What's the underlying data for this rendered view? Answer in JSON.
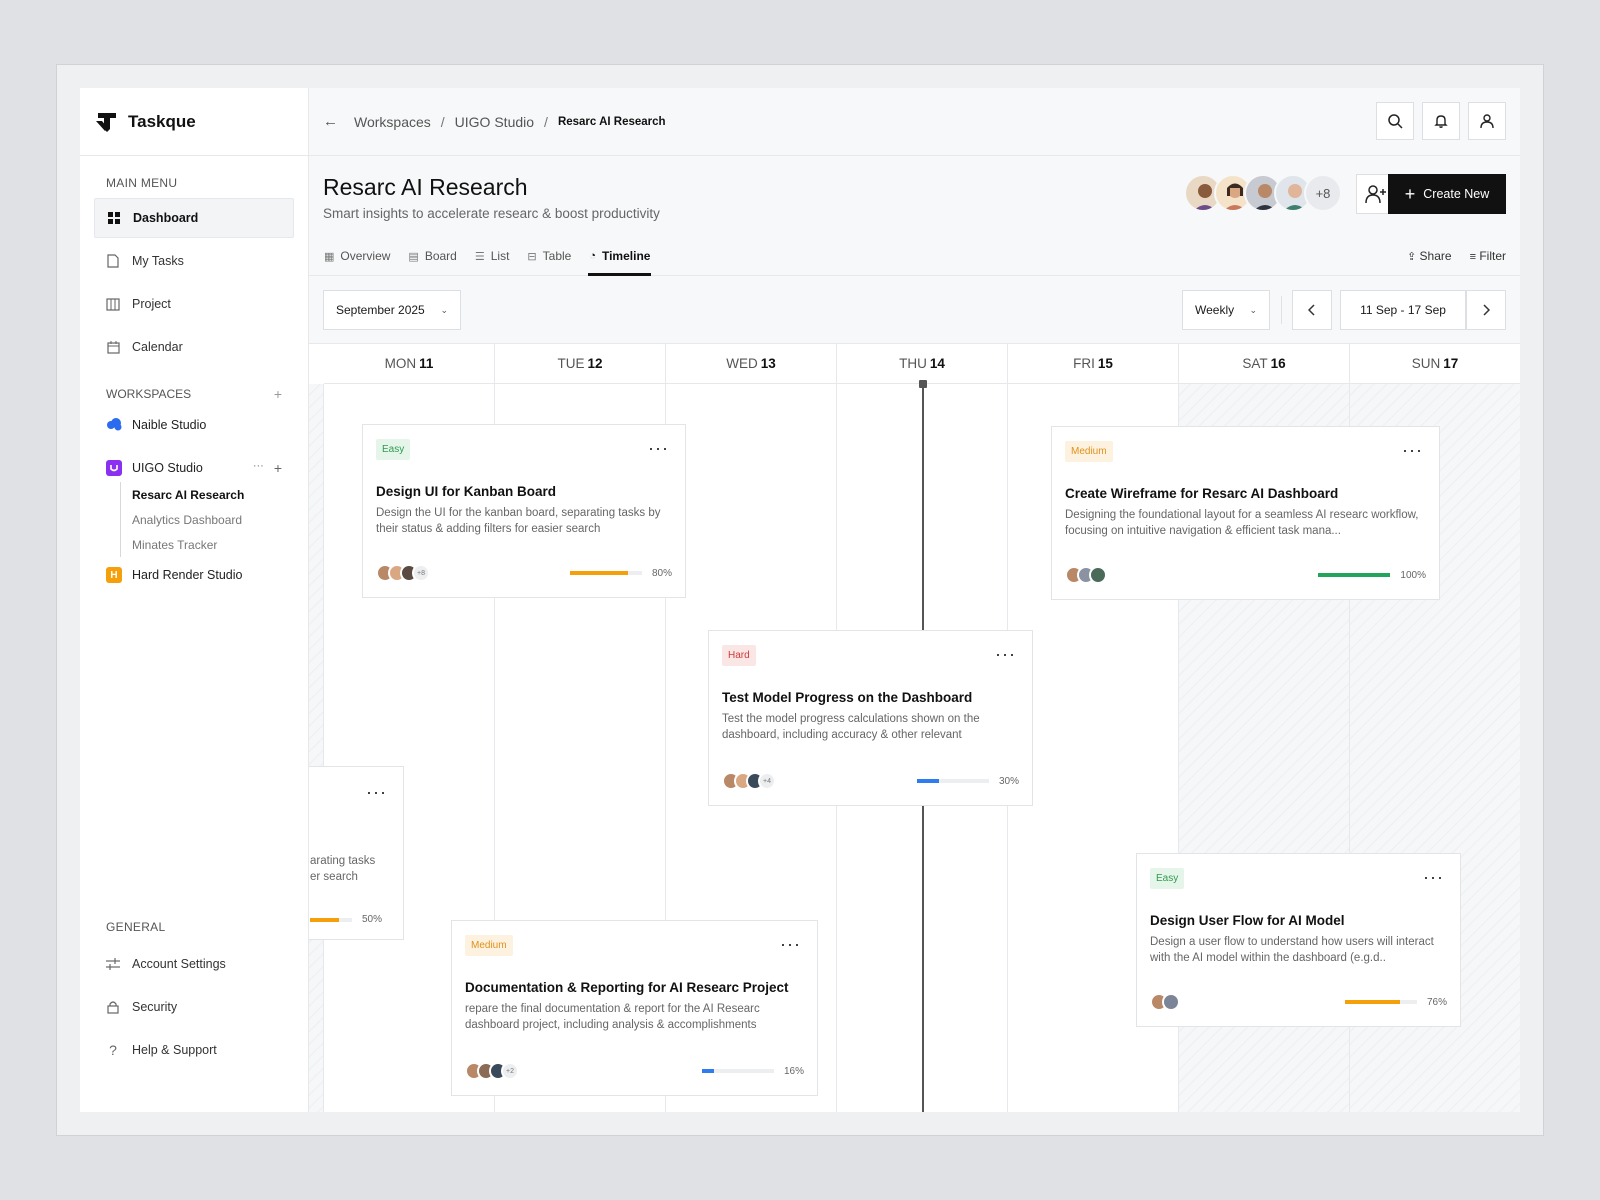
{
  "app": {
    "name": "Taskque"
  },
  "sidebar": {
    "main_menu_label": "MAIN MENU",
    "main_items": [
      {
        "label": "Dashboard",
        "icon": "grid-icon"
      },
      {
        "label": "My Tasks",
        "icon": "file-icon"
      },
      {
        "label": "Project",
        "icon": "building-icon"
      },
      {
        "label": "Calendar",
        "icon": "calendar-icon"
      }
    ],
    "workspaces_label": "WORKSPACES",
    "workspaces": [
      {
        "label": "Naible Studio",
        "color": "#2b6bf0"
      },
      {
        "label": "UIGO Studio",
        "color": "#8b2ff0"
      },
      {
        "label": "Hard Render Studio",
        "color": "#f59f0b",
        "badge": "H"
      }
    ],
    "uigo_children": [
      "Resarc AI Research",
      "Analytics Dashboard",
      "Minates Tracker"
    ],
    "general_label": "GENERAL",
    "general_items": [
      {
        "label": "Account Settings",
        "icon": "sliders-icon"
      },
      {
        "label": "Security",
        "icon": "lock-icon"
      },
      {
        "label": "Help & Support",
        "icon": "help-icon"
      }
    ]
  },
  "breadcrumb": {
    "items": [
      "Workspaces",
      "UIGO Studio"
    ],
    "current": "Resarc AI Research"
  },
  "header": {
    "title": "Resarc AI Research",
    "subtitle": "Smart insights to accelerate researc & boost productivity",
    "member_more": "+8",
    "create_label": "Create New",
    "tabs": [
      "Overview",
      "Board",
      "List",
      "Table",
      "Timeline"
    ],
    "active_tab": "Timeline",
    "share_label": "Share",
    "filter_label": "Filter"
  },
  "toolbar": {
    "month": "September 2025",
    "view": "Weekly",
    "range": "11 Sep - 17 Sep"
  },
  "days": [
    {
      "name": "MON",
      "num": "11"
    },
    {
      "name": "TUE",
      "num": "12"
    },
    {
      "name": "WED",
      "num": "13"
    },
    {
      "name": "THU",
      "num": "14"
    },
    {
      "name": "FRI",
      "num": "15"
    },
    {
      "name": "SAT",
      "num": "16"
    },
    {
      "name": "SUN",
      "num": "17"
    }
  ],
  "cards": [
    {
      "difficulty": "Easy",
      "title": "Design UI for Kanban Board",
      "desc": "Design the UI for the kanban board, separating tasks by their status & adding filters for easier search",
      "more": "+8",
      "progress": 80,
      "progress_label": "80%",
      "color": "#f59f0b"
    },
    {
      "difficulty": "Medium",
      "title": "Create Wireframe for Resarc AI Dashboard",
      "desc": "Designing the foundational layout for a seamless AI researc workflow, focusing on intuitive navigation & efficient task mana...",
      "more": "",
      "progress": 100,
      "progress_label": "100%",
      "color": "#22a55a"
    },
    {
      "difficulty": "Hard",
      "title": "Test Model Progress on the Dashboard",
      "desc": "Test the model progress calculations shown on the dashboard, including accuracy & other relevant",
      "more": "+4",
      "progress": 30,
      "progress_label": "30%",
      "color": "#2f7bf0"
    },
    {
      "difficulty": "",
      "title": "",
      "desc": "arating tasks er search",
      "desc_lines": [
        "arating tasks",
        "er search"
      ],
      "more": "",
      "progress": 50,
      "progress_label": "50%",
      "color": "#f59f0b"
    },
    {
      "difficulty": "Medium",
      "title": "Documentation & Reporting for AI Researc Project",
      "desc": "repare the final documentation & report for the AI Researc dashboard project, including analysis & accomplishments",
      "more": "+2",
      "progress": 16,
      "progress_label": "16%",
      "color": "#2f7bf0"
    },
    {
      "difficulty": "Easy",
      "title": "Design User Flow for AI Model",
      "desc": "Design a user flow to understand how users will interact with the AI model within the dashboard (e.g.d..",
      "more": "",
      "progress": 76,
      "progress_label": "76%",
      "color": "#f59f0b"
    }
  ]
}
